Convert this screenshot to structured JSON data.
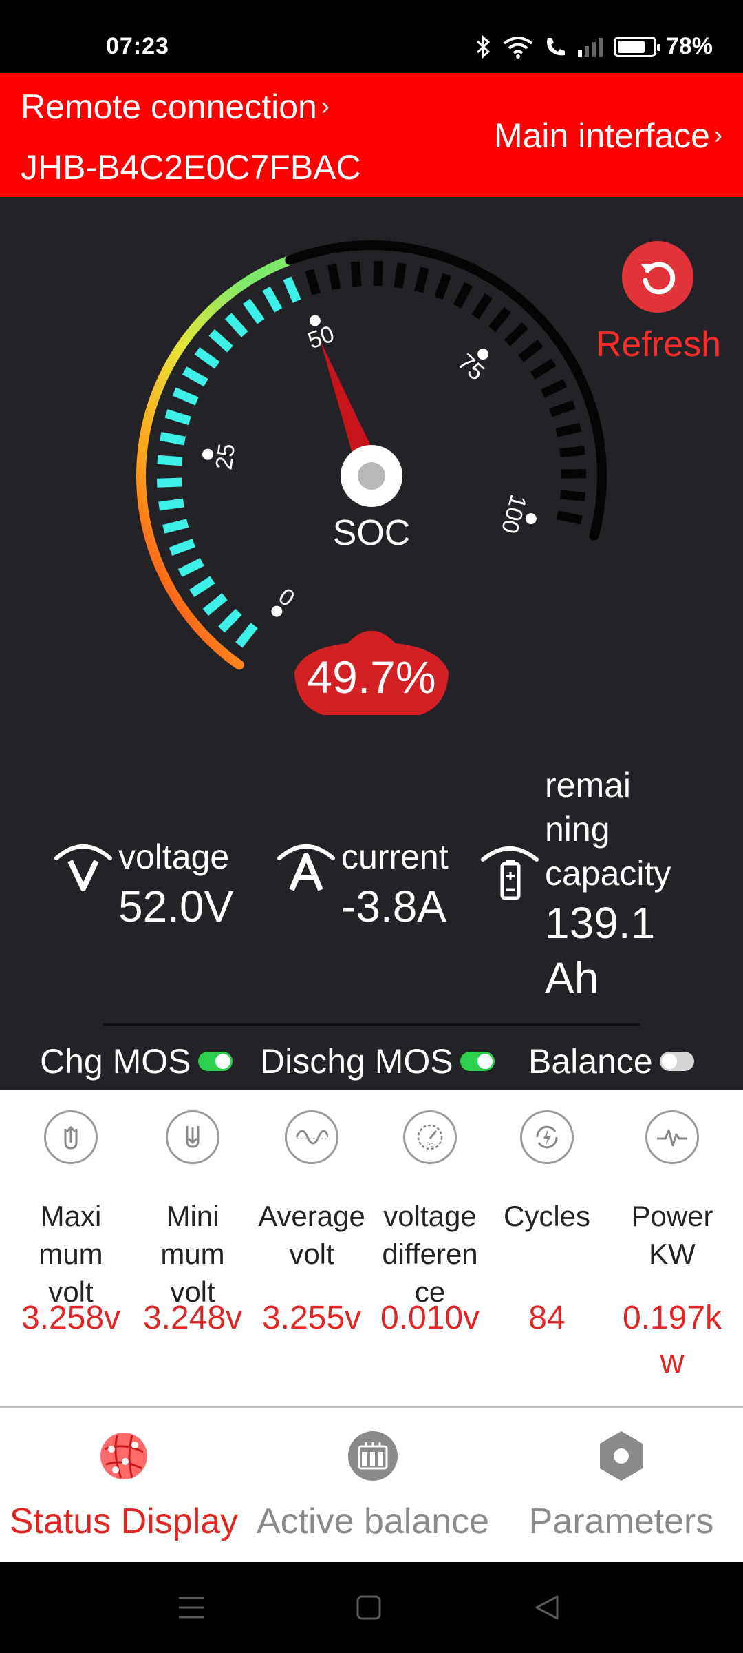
{
  "status_bar": {
    "time": "07:23",
    "battery_percent": "78%",
    "battery_level": 0.78
  },
  "header": {
    "remote_label": "Remote connection",
    "device_id": "JHB-B4C2E0C7FBAC",
    "main_interface_label": "Main interface"
  },
  "gauge": {
    "soc_label": "SOC",
    "soc_value": "49.7%",
    "soc_fraction": 0.497,
    "ticks": [
      "0",
      "25",
      "50",
      "75",
      "100"
    ]
  },
  "refresh": {
    "label": "Refresh"
  },
  "metrics": {
    "voltage": {
      "label": "voltage",
      "value": "52.0V"
    },
    "current": {
      "label": "current",
      "value": "-3.8A"
    },
    "capacity": {
      "label_lines": [
        "remai",
        "ning",
        "capacity"
      ],
      "value_lines": [
        "139.1",
        "Ah"
      ]
    }
  },
  "mos": {
    "chg_label": "Chg MOS",
    "chg_on": true,
    "dischg_label": "Dischg MOS",
    "dischg_on": true,
    "balance_label": "Balance",
    "balance_on": false
  },
  "stats": [
    {
      "label_lines": [
        "Maxi",
        "mum",
        "volt"
      ],
      "value_lines": [
        "3.258v"
      ]
    },
    {
      "label_lines": [
        "Mini",
        "mum",
        "volt"
      ],
      "value_lines": [
        "3.248v"
      ]
    },
    {
      "label_lines": [
        "Average",
        "volt"
      ],
      "value_lines": [
        "3.255v"
      ]
    },
    {
      "label_lines": [
        "voltage",
        "differen",
        "ce"
      ],
      "value_lines": [
        "0.010v"
      ]
    },
    {
      "label_lines": [
        "Cycles"
      ],
      "value_lines": [
        "84"
      ]
    },
    {
      "label_lines": [
        "Power",
        "KW"
      ],
      "value_lines": [
        "0.197k",
        "w"
      ]
    }
  ],
  "nav": {
    "status_display": "Status Display",
    "active_balance": "Active balance",
    "parameters": "Parameters"
  },
  "colors": {
    "header_red": "#ff0000",
    "accent_red": "#e12424",
    "panel_dark": "#232327",
    "gauge_cyan": "#3df0e8",
    "toggle_green": "#2bd14e",
    "nav_gray": "#8a8a8a"
  }
}
